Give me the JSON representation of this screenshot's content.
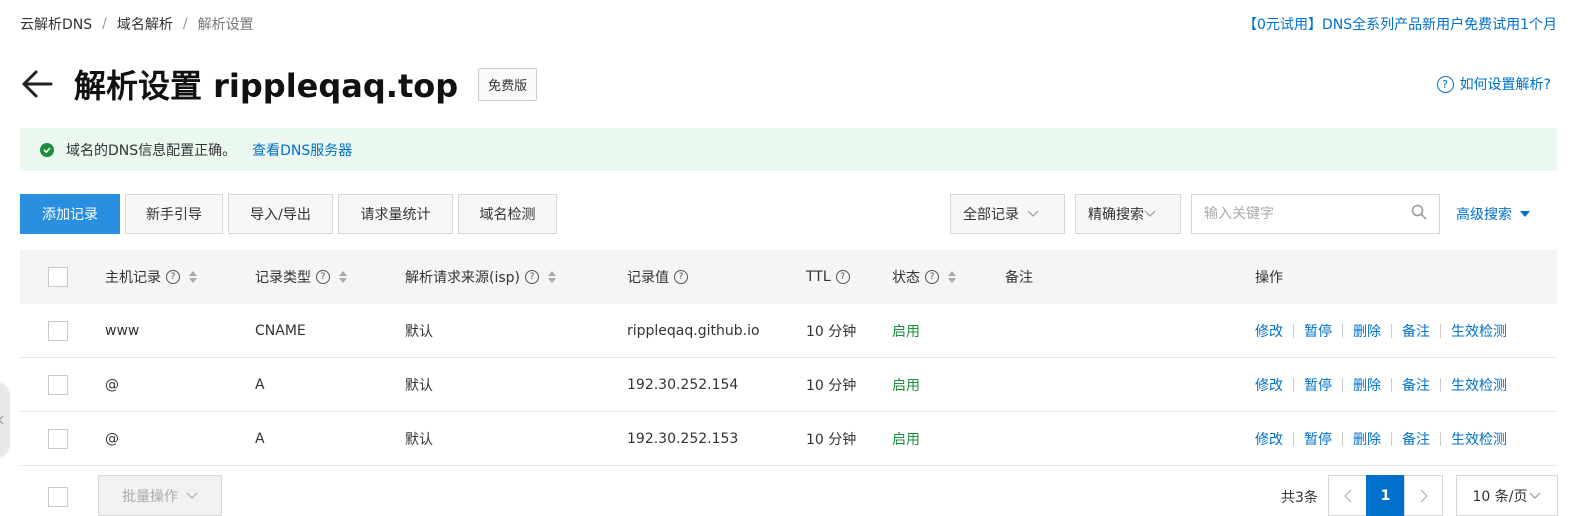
{
  "breadcrumb": {
    "items": [
      "云解析DNS",
      "域名解析",
      "解析设置"
    ],
    "separator": "/"
  },
  "promo": "【0元试用】DNS全系列产品新用户免费试用1个月",
  "title": {
    "text": "解析设置 rippleqaq.top",
    "edition": "免费版"
  },
  "help_link": "如何设置解析?",
  "alert": {
    "message": "域名的DNS信息配置正确。",
    "link": "查看DNS服务器"
  },
  "toolbar": {
    "add_record": "添加记录",
    "guide": "新手引导",
    "import_export": "导入/导出",
    "request_stats": "请求量统计",
    "domain_check": "域名检测"
  },
  "filters": {
    "record_scope": "全部记录",
    "search_mode": "精确搜索",
    "search_placeholder": "输入关键字",
    "advanced": "高级搜索"
  },
  "columns": {
    "host": "主机记录",
    "type": "记录类型",
    "isp": "解析请求来源(isp)",
    "value": "记录值",
    "ttl": "TTL",
    "status": "状态",
    "remark": "备注",
    "actions": "操作"
  },
  "rows": [
    {
      "host": "www",
      "type": "CNAME",
      "isp": "默认",
      "value": "rippleqaq.github.io",
      "ttl": "10 分钟",
      "status": "启用",
      "remark": ""
    },
    {
      "host": "@",
      "type": "A",
      "isp": "默认",
      "value": "192.30.252.154",
      "ttl": "10 分钟",
      "status": "启用",
      "remark": ""
    },
    {
      "host": "@",
      "type": "A",
      "isp": "默认",
      "value": "192.30.252.153",
      "ttl": "10 分钟",
      "status": "启用",
      "remark": ""
    }
  ],
  "row_actions": {
    "edit": "修改",
    "pause": "暂停",
    "delete": "删除",
    "note": "备注",
    "check": "生效检测"
  },
  "footer": {
    "bulk": "批量操作",
    "total": "共3条",
    "current_page": "1",
    "page_size": "10 条/页"
  },
  "colors": {
    "primary": "#2a8fe0",
    "link": "#0070cc",
    "success": "#1e8e3e",
    "alert_bg": "#ebf8f0"
  }
}
